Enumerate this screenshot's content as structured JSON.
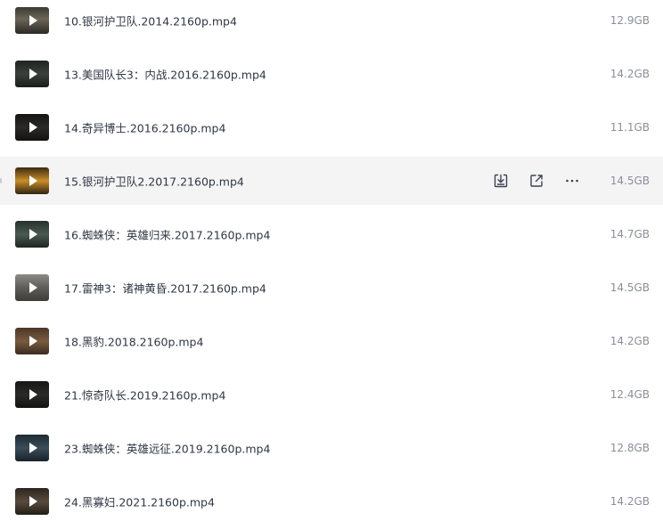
{
  "files": [
    {
      "name": "10.银河护卫队.2014.2160p.mp4",
      "size": "12.9GB",
      "thumb_bg": "linear-gradient(180deg,#3b3a35 0%,#6b6656 45%,#2a2824 100%)",
      "hovered": false
    },
    {
      "name": "13.美国队长3：内战.2016.2160p.mp4",
      "size": "14.2GB",
      "thumb_bg": "linear-gradient(180deg,#1f2421 0%,#3a403a 50%,#1a1d1b 100%)",
      "hovered": false
    },
    {
      "name": "14.奇异博士.2016.2160p.mp4",
      "size": "11.1GB",
      "thumb_bg": "linear-gradient(180deg,#141414 0%,#2c2a28 50%,#121212 100%)",
      "hovered": false
    },
    {
      "name": "15.银河护卫队2.2017.2160p.mp4",
      "size": "14.5GB",
      "thumb_bg": "linear-gradient(180deg,#3a2a12 0%,#c98d2a 50%,#2f2410 100%)",
      "hovered": true
    },
    {
      "name": "16.蜘蛛侠：英雄归来.2017.2160p.mp4",
      "size": "14.7GB",
      "thumb_bg": "linear-gradient(180deg,#27302c 0%,#4a5a52 50%,#1d2421 100%)",
      "hovered": false
    },
    {
      "name": "17.雷神3：诸神黄昏.2017.2160p.mp4",
      "size": "14.5GB",
      "thumb_bg": "linear-gradient(180deg,#8c8a84 0%,#5f5d58 50%,#3d3c39 100%)",
      "hovered": false
    },
    {
      "name": "18.黑豹.2018.2160p.mp4",
      "size": "14.2GB",
      "thumb_bg": "linear-gradient(180deg,#4a3626 0%,#7a5b40 50%,#3a2b20 100%)",
      "hovered": false
    },
    {
      "name": "21.惊奇队长.2019.2160p.mp4",
      "size": "12.4GB",
      "thumb_bg": "linear-gradient(180deg,#161616 0%,#2a2a28 50%,#121212 100%)",
      "hovered": false
    },
    {
      "name": "23.蜘蛛侠：英雄远征.2019.2160p.mp4",
      "size": "12.8GB",
      "thumb_bg": "linear-gradient(180deg,#1e2a33 0%,#3b4d5a 50%,#182229 100%)",
      "hovered": false
    },
    {
      "name": "24.黑寡妇.2021.2160p.mp4",
      "size": "14.2GB",
      "thumb_bg": "linear-gradient(180deg,#2b2520 0%,#5a4a3c 50%,#221d19 100%)",
      "hovered": false
    }
  ],
  "row_actions": {
    "download_icon": "download-icon",
    "share_icon": "share-icon",
    "more_icon": "more-icon"
  },
  "colors": {
    "name_text": "#2f3744",
    "size_text": "#8a8f99",
    "hover_bg": "#f4f4f5",
    "icon": "#3d4350"
  }
}
